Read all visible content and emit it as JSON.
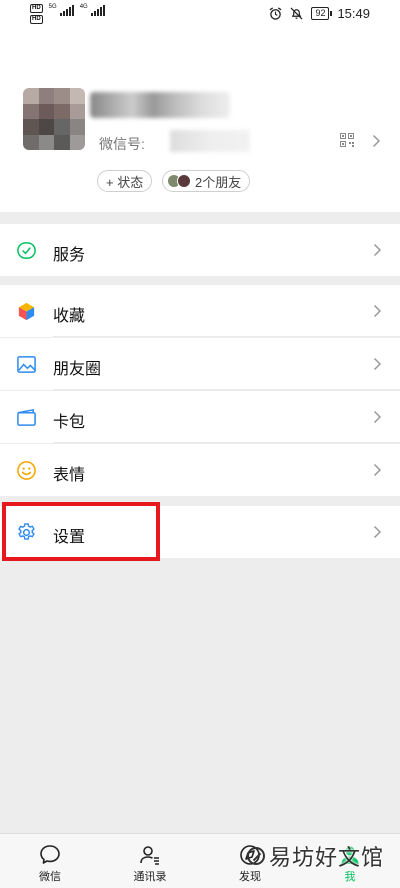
{
  "status_bar": {
    "hd1": "HD",
    "hd2": "HD",
    "net1": "5G",
    "net2": "4G",
    "battery": "92",
    "time": "15:49"
  },
  "profile": {
    "wechat_id_label": "微信号:",
    "status_button": "+ 状态",
    "friends_button": "2个朋友"
  },
  "menu": {
    "services": "服务",
    "favorites": "收藏",
    "moments": "朋友圈",
    "cards": "卡包",
    "stickers": "表情",
    "settings": "设置"
  },
  "tabbar": {
    "chats": "微信",
    "contacts": "通讯录",
    "discover": "发现",
    "me": "我"
  },
  "watermark": "易坊好文馆",
  "colors": {
    "accent_green": "#07c160",
    "highlight_red": "#e8191e"
  }
}
